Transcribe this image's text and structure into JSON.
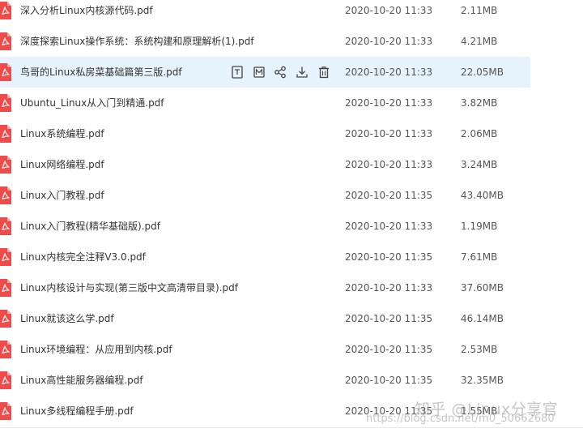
{
  "files": [
    {
      "name": "深入分析Linux内核源代码.pdf",
      "date": "2020-10-20 11:33",
      "size": "2.11MB",
      "icon": "pdf-file-icon"
    },
    {
      "name": "深度探索Linux操作系统：系统构建和原理解析(1).pdf",
      "date": "2020-10-20 11:33",
      "size": "4.21MB",
      "icon": "pdf-file-icon"
    },
    {
      "name": "鸟哥的Linux私房菜基础篇第三版.pdf",
      "date": "2020-10-20 11:33",
      "size": "22.05MB",
      "icon": "pdf-file-icon",
      "highlighted": true
    },
    {
      "name": "Ubuntu_Linux从入门到精通.pdf",
      "date": "2020-10-20 11:33",
      "size": "3.82MB",
      "icon": "pdf-file-icon"
    },
    {
      "name": "Linux系统编程.pdf",
      "date": "2020-10-20 11:33",
      "size": "2.06MB",
      "icon": "pdf-file-icon"
    },
    {
      "name": "Linux网络编程.pdf",
      "date": "2020-10-20 11:33",
      "size": "3.24MB",
      "icon": "pdf-file-icon"
    },
    {
      "name": "Linux入门教程.pdf",
      "date": "2020-10-20 11:35",
      "size": "43.40MB",
      "icon": "pdf-file-icon"
    },
    {
      "name": "Linux入门教程(精华基础版).pdf",
      "date": "2020-10-20 11:33",
      "size": "1.19MB",
      "icon": "pdf-file-icon"
    },
    {
      "name": "Linux内核完全注释V3.0.pdf",
      "date": "2020-10-20 11:35",
      "size": "7.61MB",
      "icon": "pdf-file-icon"
    },
    {
      "name": "Linux内核设计与实现(第三版中文高清带目录).pdf",
      "date": "2020-10-20 11:33",
      "size": "37.60MB",
      "icon": "pdf-file-icon"
    },
    {
      "name": "Linux就该这么学.pdf",
      "date": "2020-10-20 11:35",
      "size": "46.14MB",
      "icon": "pdf-file-icon"
    },
    {
      "name": "Linux环境编程：从应用到内核.pdf",
      "date": "2020-10-20 11:35",
      "size": "2.53MB",
      "icon": "pdf-file-icon"
    },
    {
      "name": "Linux高性能服务器编程.pdf",
      "date": "2020-10-20 11:35",
      "size": "32.35MB",
      "icon": "pdf-file-icon"
    },
    {
      "name": "Linux多线程编程手册.pdf",
      "date": "2020-10-20 11:35",
      "size": "1.55MB",
      "icon": "pdf-file-icon"
    }
  ],
  "row_actions": [
    {
      "name": "preview-icon"
    },
    {
      "name": "save-to-drive-icon"
    },
    {
      "name": "share-icon"
    },
    {
      "name": "download-icon"
    },
    {
      "name": "delete-icon"
    }
  ],
  "watermark": {
    "main": "知乎 @Linux分享官",
    "url": "https://blog.csdn.net/m0_50662680"
  },
  "colors": {
    "pdf_red": "#ef4b4b",
    "highlight_bg": "#e7f3fc",
    "action_icon": "#444444"
  }
}
